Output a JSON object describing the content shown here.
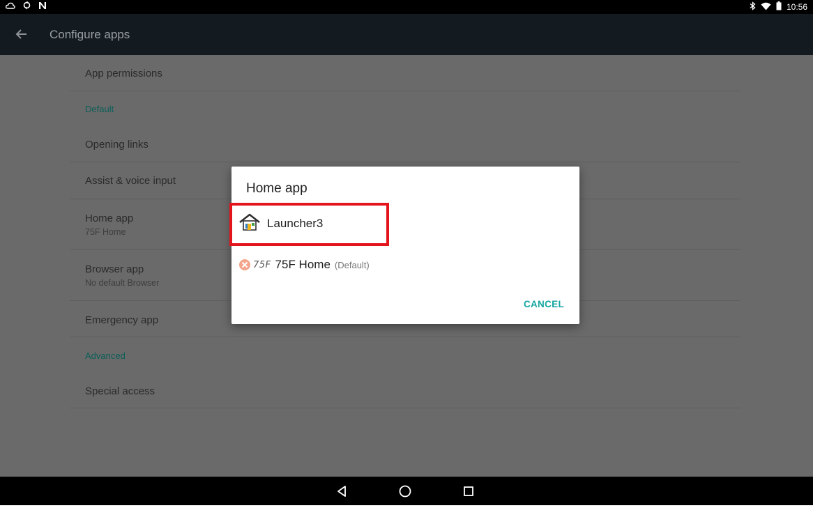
{
  "status_bar": {
    "time": "10:56",
    "left_icons": [
      "cloud-icon",
      "sync-icon",
      "n-notification-icon"
    ],
    "right_icons": [
      "bluetooth-icon",
      "wifi-icon",
      "battery-icon"
    ]
  },
  "action_bar": {
    "title": "Configure apps"
  },
  "settings": {
    "app_permissions": "App permissions",
    "default_header": "Default",
    "opening_links": "Opening links",
    "assist_voice_input": "Assist & voice input",
    "home_app": {
      "label": "Home app",
      "summary": "75F Home"
    },
    "browser_app": {
      "label": "Browser app",
      "summary": "No default Browser"
    },
    "emergency_app": "Emergency app",
    "advanced_header": "Advanced",
    "special_access": "Special access"
  },
  "dialog": {
    "title": "Home app",
    "options": [
      {
        "label": "Launcher3",
        "suffix": "",
        "icon": "launcher3-house-icon"
      },
      {
        "label": "75F Home",
        "suffix": "(Default)",
        "icon": "75f-logo-icon",
        "logo_text": "75F"
      }
    ],
    "cancel_label": "CANCEL"
  },
  "colors": {
    "accent": "#14a6a0",
    "header_text": "#0b5f58",
    "highlight": "#e3141c",
    "scrim_background": "#6a6a6a",
    "action_bar": "#131a20"
  }
}
